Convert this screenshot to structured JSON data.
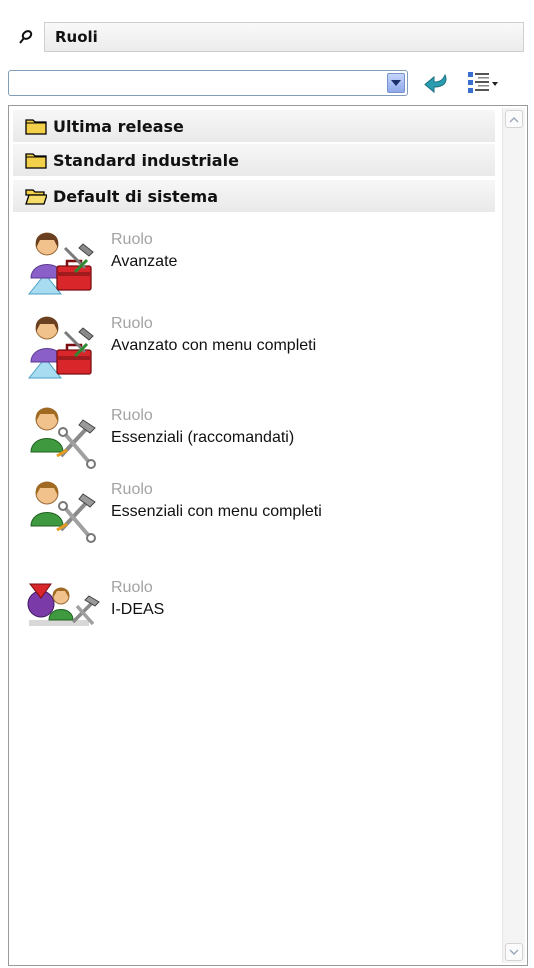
{
  "panel": {
    "title": "Ruoli",
    "search": {
      "value": "",
      "placeholder": ""
    }
  },
  "folders": [
    {
      "label": "Ultima release",
      "state": "closed"
    },
    {
      "label": "Standard industriale",
      "state": "closed"
    },
    {
      "label": "Default di sistema",
      "state": "open"
    }
  ],
  "roles": [
    {
      "kind": "Ruolo",
      "name": "Avanzate",
      "icon": "advanced-role-icon"
    },
    {
      "kind": "Ruolo",
      "name": "Avanzato con menu completi",
      "icon": "advanced-role-icon"
    },
    {
      "kind": "Ruolo",
      "name": "Essenziali (raccomandati)",
      "icon": "essential-role-icon"
    },
    {
      "kind": "Ruolo",
      "name": "Essenziali con menu completi",
      "icon": "essential-role-icon"
    },
    {
      "kind": "Ruolo",
      "name": "I-DEAS",
      "icon": "ideas-role-icon"
    }
  ],
  "colors": {
    "accent": "#2a9db0",
    "folder": "#f2d04a",
    "toolbox": "#d8262b",
    "role_kind": "#a3a3a3"
  }
}
